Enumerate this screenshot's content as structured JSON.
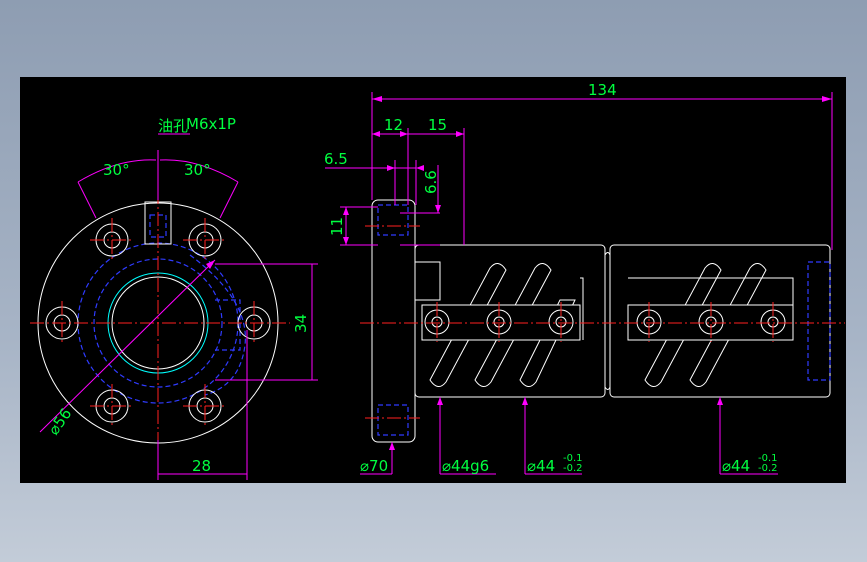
{
  "colors": {
    "background": "#000000",
    "outline": "#ffffff",
    "dimension_line": "#ff00ff",
    "dimension_text": "#00ff40",
    "center_line": "#ff2020",
    "hidden_line": "#2f3bff"
  },
  "labels": {
    "oil_hole": "油孔",
    "thread": "M6x1P",
    "angle_left": "30°",
    "angle_right": "30°",
    "pcd": "⌀56",
    "width_28": "28",
    "height_34": "34",
    "overall_134": "134",
    "len_12": "12",
    "len_15": "15",
    "len_6_5": "6.5",
    "len_6_6": "6.6",
    "len_11": "11",
    "dia_70": "⌀70",
    "dia_44g6": "⌀44g6",
    "dia_44_a": "⌀44",
    "tol_a_upper": "-0.1",
    "tol_a_lower": "-0.2",
    "dia_44_b": "⌀44",
    "tol_b_upper": "-0.1",
    "tol_b_lower": "-0.2"
  }
}
